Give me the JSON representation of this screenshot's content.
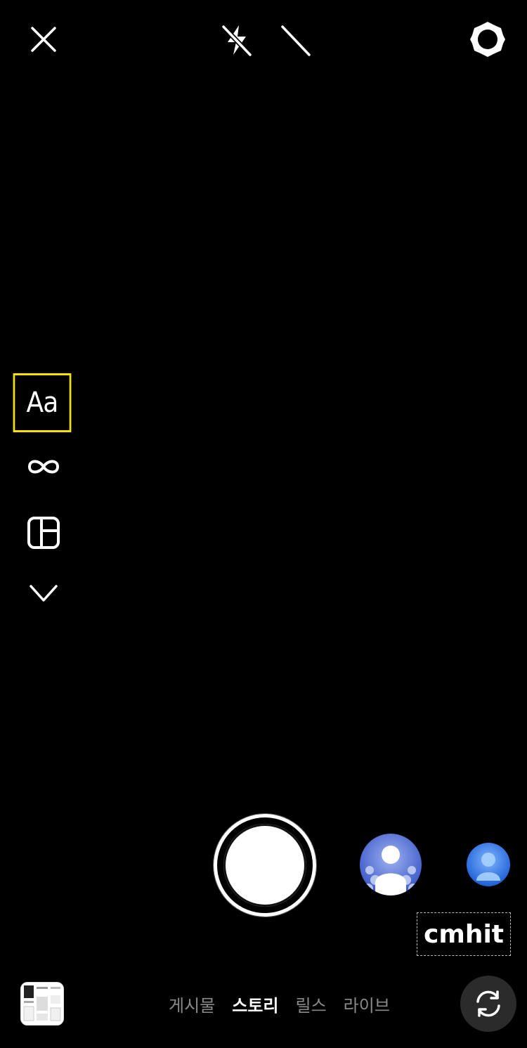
{
  "top_bar": {
    "close_icon": "close-icon",
    "flash_icon": "flash-off-icon",
    "night_mode_icon": "night-mode-off-icon",
    "settings_icon": "gear-icon"
  },
  "tool_rail": {
    "text_mode_label": "Aa",
    "boomerang_icon": "infinity-icon",
    "layout_icon": "layout-grid-icon",
    "more_icon": "chevron-down-icon",
    "selected_color": "#f4e300"
  },
  "capture": {
    "shutter_icon": "shutter-button",
    "effects": [
      {
        "name": "effect-crowd-silhouette",
        "color": "#4a6ad8"
      },
      {
        "name": "effect-blue-avatar",
        "color": "#2f7be8"
      }
    ],
    "filter_label": "cmhit"
  },
  "bottom_bar": {
    "modes": [
      {
        "label": "게시물",
        "active": false
      },
      {
        "label": "스토리",
        "active": true
      },
      {
        "label": "릴스",
        "active": false
      },
      {
        "label": "라이브",
        "active": false
      }
    ],
    "flip_camera_icon": "flip-camera-icon"
  }
}
